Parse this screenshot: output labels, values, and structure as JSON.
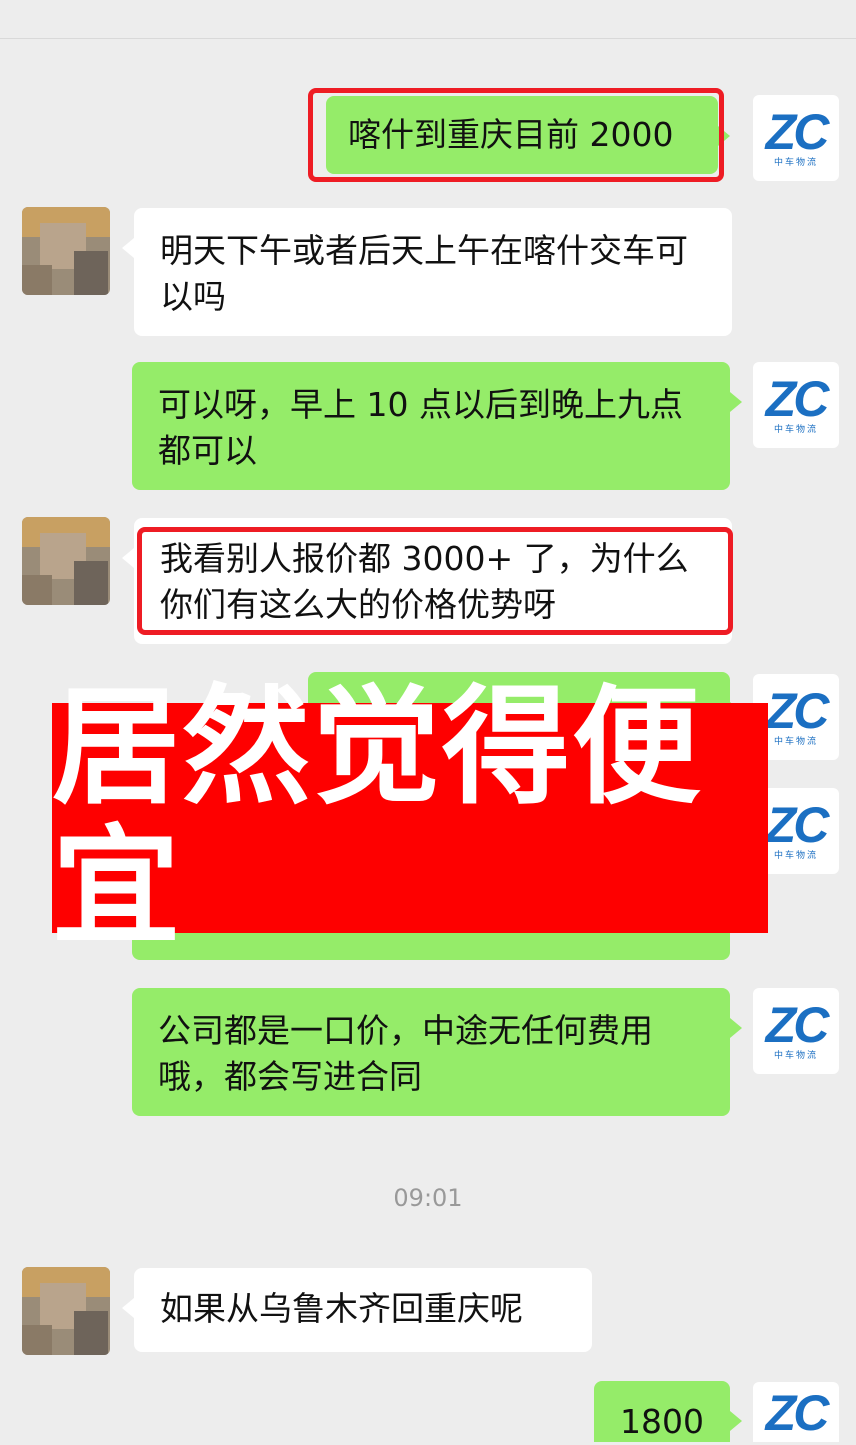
{
  "messages": [
    {
      "text": "喀什到重庆目前 2000"
    },
    {
      "text": "明天下午或者后天上午在喀什交车可以吗"
    },
    {
      "text": "可以呀，早上 10 点以后到晚上九点都可以"
    },
    {
      "text": "我看别人报价都 3000+ 了，为什么你们有这么大的价格优势呀"
    },
    {
      "text": "公司都是一口价，中途无任何费用哦，都会写进合同"
    },
    {
      "text": "如果从乌鲁木齐回重庆呢"
    },
    {
      "text": "1800"
    }
  ],
  "timestamp": "09:01",
  "banner": {
    "text": "居然觉得便宜"
  },
  "avatar": {
    "brand": "ZC",
    "brand_sub": "中车物流"
  },
  "colors": {
    "outgoing": "#95ec69",
    "incoming": "#ffffff",
    "highlight": "#ee1c24",
    "banner": "#fe0000",
    "brand": "#1b6fc2"
  }
}
